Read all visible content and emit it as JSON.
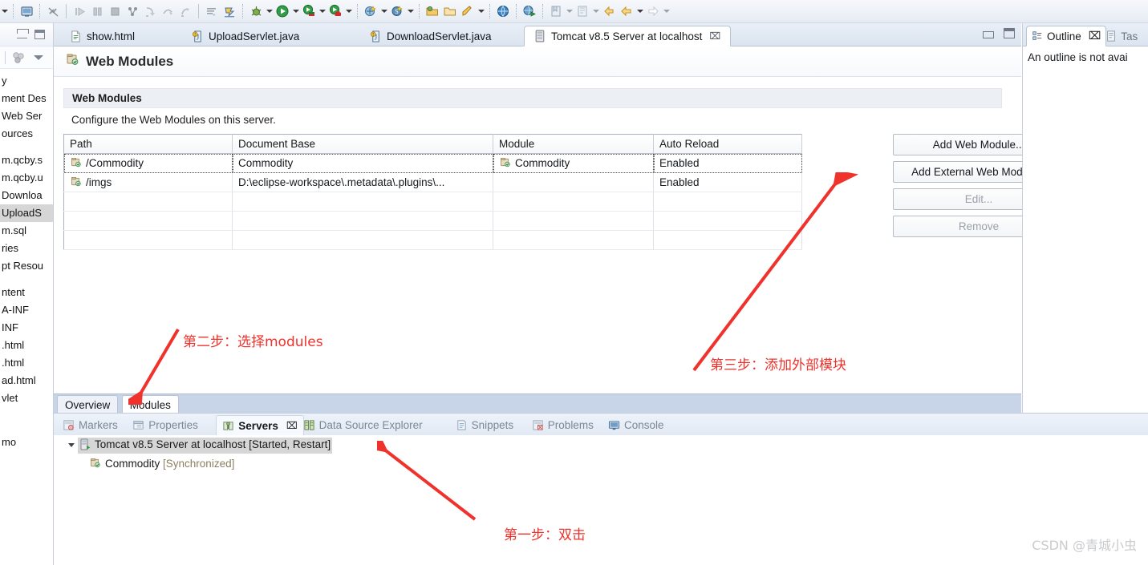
{
  "toolbar": {
    "groups": [
      {
        "icons": [
          "dropdown-caret"
        ]
      },
      {
        "icons": [
          "new-window-icon",
          "separator"
        ]
      },
      {
        "icons": [
          "link-broken-icon"
        ]
      },
      {
        "icons": [
          "resume-icon",
          "suspend-icon",
          "terminate-icon",
          "disconnect-icon",
          "step-into-icon",
          "step-over-icon",
          "step-return-icon"
        ]
      },
      {
        "icons": [
          "skip-breakpoints-icon",
          "drop-to-frame-icon"
        ]
      },
      {
        "icons": [
          "debug-icon",
          "run-icon",
          "run-server-icon",
          "stop-server-icon"
        ]
      },
      {
        "icons": [
          "new-wizard-icon",
          "search-icon",
          "open-folder-icon",
          "open-folder2-icon",
          "brush-icon",
          "globe-icon",
          "run-web-icon",
          "external-tools-icon",
          "bookmark-icon",
          "back-icon",
          "back2-icon",
          "forward-icon"
        ]
      }
    ]
  },
  "package_explorer": {
    "items": [
      {
        "label": "y",
        "selected": false
      },
      {
        "label": "ment Des",
        "selected": false
      },
      {
        "label": " Web Ser",
        "selected": false
      },
      {
        "label": "ources",
        "selected": false
      },
      {
        "label": "",
        "selected": false
      },
      {
        "label": "m.qcby.s",
        "selected": false
      },
      {
        "label": "m.qcby.u",
        "selected": false
      },
      {
        "label": " Downloa",
        "selected": false
      },
      {
        "label": " UploadS",
        "selected": true
      },
      {
        "label": "m.sql",
        "selected": false
      },
      {
        "label": "ries",
        "selected": false
      },
      {
        "label": "pt Resou",
        "selected": false
      },
      {
        "label": "",
        "selected": false
      },
      {
        "label": "ntent",
        "selected": false
      },
      {
        "label": "A-INF",
        "selected": false
      },
      {
        "label": "INF",
        "selected": false
      },
      {
        "label": ".html",
        "selected": false
      },
      {
        "label": ".html",
        "selected": false
      },
      {
        "label": "ad.html",
        "selected": false
      },
      {
        "label": "vlet",
        "selected": false
      },
      {
        "label": "",
        "selected": false
      },
      {
        "label": "",
        "selected": false
      },
      {
        "label": "",
        "selected": false
      },
      {
        "label": "mo",
        "selected": false
      }
    ]
  },
  "editor": {
    "tabs": [
      {
        "label": "show.html",
        "icon": "html-file-icon",
        "active": false
      },
      {
        "label": "UploadServlet.java",
        "icon": "java-file-icon",
        "active": false
      },
      {
        "label": "DownloadServlet.java",
        "icon": "java-file-icon",
        "active": false
      },
      {
        "label": "Tomcat v8.5 Server at localhost",
        "icon": "server-icon",
        "active": true,
        "close": "⌧"
      }
    ],
    "window_buttons": [
      "minimize",
      "maximize"
    ],
    "form_title": "Web Modules",
    "form_title_icon": "web-module-icon",
    "section_title": "Web Modules",
    "section_description": "Configure the Web Modules on this server.",
    "table": {
      "columns": [
        "Path",
        "Document Base",
        "Module",
        "Auto Reload"
      ],
      "rows": [
        {
          "path": "/Commodity",
          "path_icon": "web-module-icon",
          "document_base": "Commodity",
          "module": "Commodity",
          "module_icon": "web-module-icon",
          "auto_reload": "Enabled",
          "selected": true
        },
        {
          "path": "/imgs",
          "path_icon": "web-module-icon",
          "document_base": "D:\\eclipse-workspace\\.metadata\\.plugins\\...",
          "module": "",
          "module_icon": "",
          "auto_reload": "Enabled",
          "selected": false
        },
        {
          "path": "",
          "path_icon": "",
          "document_base": "",
          "module": "",
          "module_icon": "",
          "auto_reload": "",
          "selected": false
        },
        {
          "path": "",
          "path_icon": "",
          "document_base": "",
          "module": "",
          "module_icon": "",
          "auto_reload": "",
          "selected": false
        },
        {
          "path": "",
          "path_icon": "",
          "document_base": "",
          "module": "",
          "module_icon": "",
          "auto_reload": "",
          "selected": false
        }
      ]
    },
    "buttons": [
      {
        "label": "Add Web Module...",
        "enabled": true
      },
      {
        "label": "Add External Web Module...",
        "enabled": true
      },
      {
        "label": "Edit...",
        "enabled": false
      },
      {
        "label": "Remove",
        "enabled": false
      }
    ],
    "bottom_tabs": [
      {
        "label": "Overview",
        "active": false
      },
      {
        "label": "Modules",
        "active": true
      }
    ]
  },
  "outline": {
    "tabs": [
      {
        "label": "Outline",
        "icon": "outline-icon",
        "active": true,
        "close": "⌧"
      },
      {
        "label": "Tas",
        "icon": "task-icon",
        "active": false
      }
    ],
    "message": "An outline is not avai"
  },
  "bottom_views": {
    "tabs": [
      {
        "label": "Markers",
        "icon": "markers-icon",
        "active": false
      },
      {
        "label": "Properties",
        "icon": "properties-icon",
        "active": false
      },
      {
        "label": "Servers",
        "icon": "servers-icon",
        "active": true,
        "close": "⌧"
      },
      {
        "label": "Data Source Explorer",
        "icon": "datasource-icon",
        "active": false
      },
      {
        "label": "Snippets",
        "icon": "snippets-icon",
        "active": false
      },
      {
        "label": "Problems",
        "icon": "problems-icon",
        "active": false
      },
      {
        "label": "Console",
        "icon": "console-icon",
        "active": false
      }
    ],
    "servers_tree": {
      "server": {
        "name": "Tomcat v8.5 Server at localhost",
        "status": "[Started, Restart]",
        "icon": "server-icon",
        "expanded": true,
        "selected": true
      },
      "module": {
        "name": "Commodity",
        "status": "[Synchronized]",
        "icon": "web-module-icon"
      }
    }
  },
  "annotations": [
    {
      "id": "step2",
      "text": "第二步：选择modules"
    },
    {
      "id": "step3",
      "text": "第三步：添加外部模块"
    },
    {
      "id": "step1",
      "text": "第一步：双击"
    }
  ],
  "watermark": "CSDN @青城小虫",
  "colors": {
    "annotation_red": "#f0322c",
    "tab_active_bg": "#ffffff",
    "selection_gray": "#d6d6d6",
    "editor_bottom_bar": "#c8d5e8"
  }
}
